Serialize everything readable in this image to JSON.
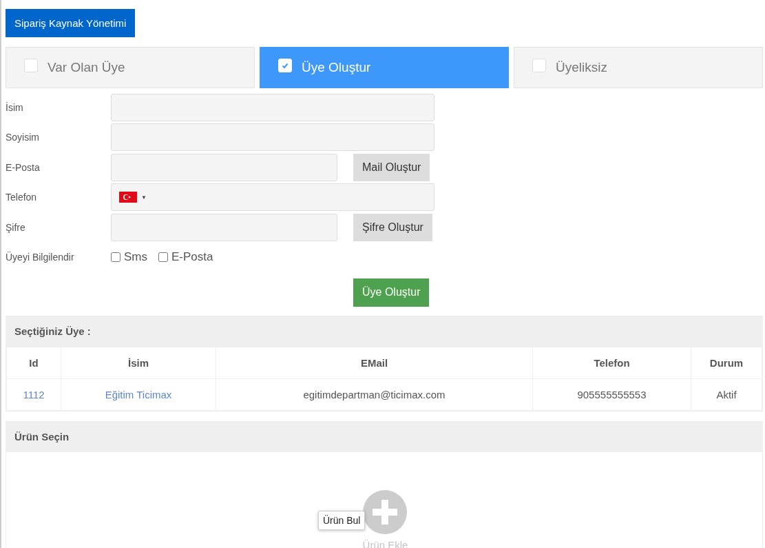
{
  "header_button": "Sipariş Kaynak Yönetimi",
  "tabs": [
    {
      "label": "Var Olan Üye",
      "selected": false
    },
    {
      "label": "Üye Oluştur",
      "selected": true
    },
    {
      "label": "Üyeliksiz",
      "selected": false
    }
  ],
  "form": {
    "fields": [
      {
        "kind": "text",
        "label": "İsim"
      },
      {
        "kind": "text",
        "label": "Soyisim"
      },
      {
        "kind": "text_button",
        "label": "E-Posta",
        "button": "Mail Oluştur"
      },
      {
        "kind": "phone",
        "label": "Telefon",
        "dropdown_arrow": "▼"
      },
      {
        "kind": "text_button",
        "label": "Şifre",
        "button": "Şifre Oluştur"
      },
      {
        "kind": "checks",
        "label": "Üyeyi Bilgilendir",
        "options": [
          {
            "label": "Sms",
            "checked": false
          },
          {
            "label": "E-Posta",
            "checked": false
          }
        ]
      }
    ],
    "submit": "Üye Oluştur"
  },
  "selected_member": {
    "title": "Seçtiğiniz Üye :",
    "columns": [
      "Id",
      "İsim",
      "EMail",
      "Telefon",
      "Durum"
    ],
    "rows": [
      {
        "id": "1112",
        "name": "Eğitim Ticimax",
        "email": "egitimdepartman@ticimax.com",
        "phone": "905555555553",
        "status": "Aktif"
      }
    ]
  },
  "products": {
    "title": "Ürün Seçin",
    "add_link": "Ürün Ekle",
    "tooltip": "Ürün Bul"
  }
}
